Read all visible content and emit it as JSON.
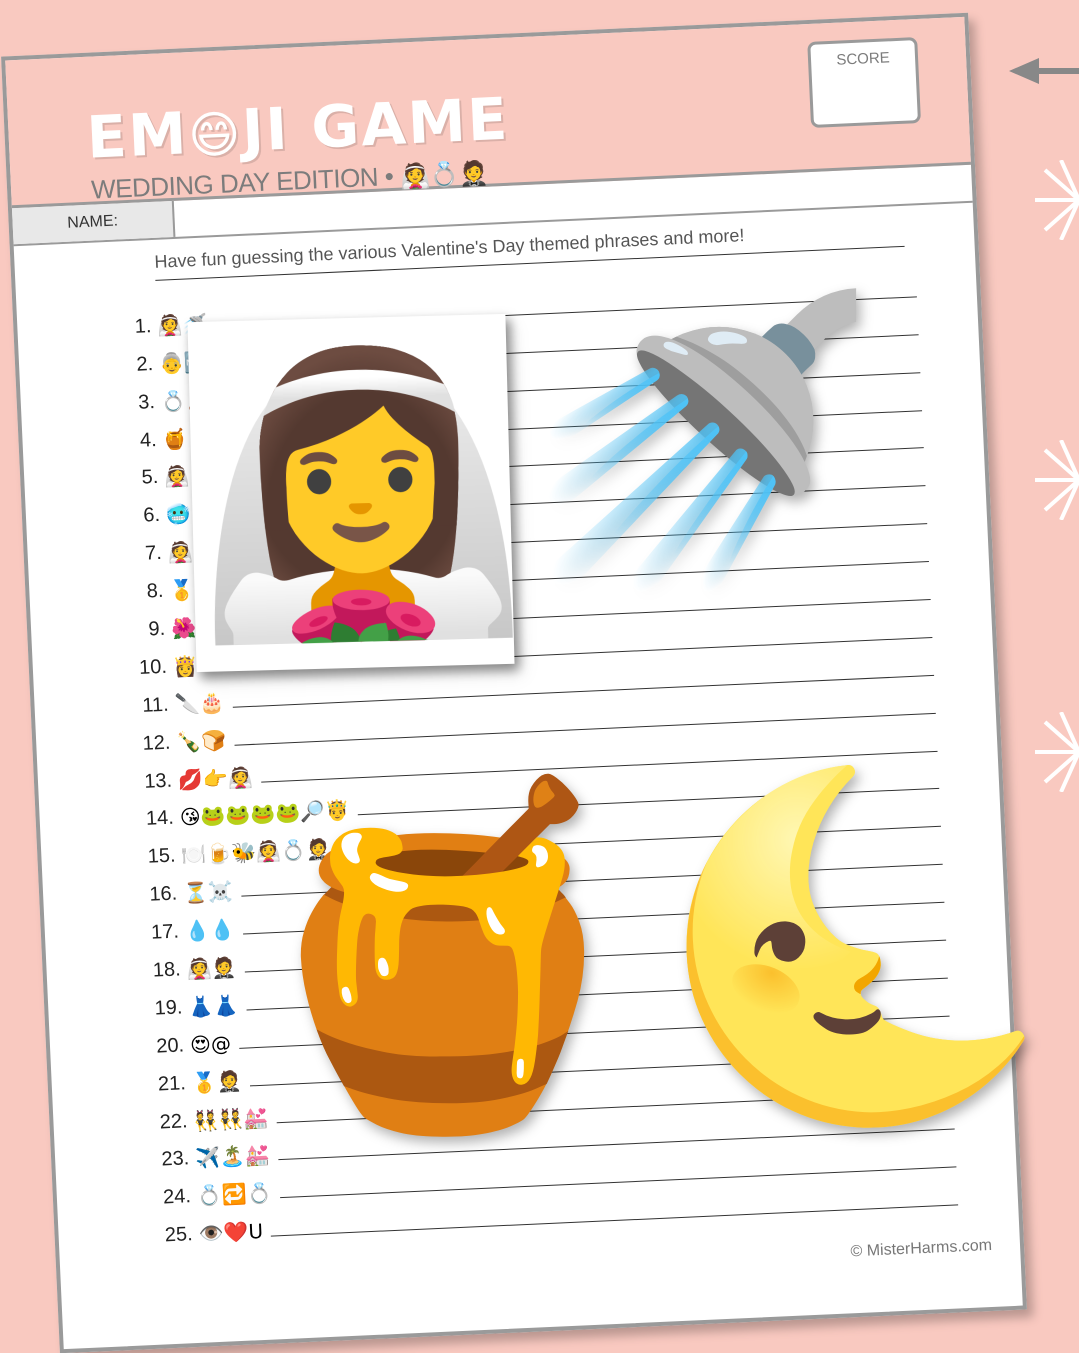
{
  "page": {
    "background": "#f9c9c0",
    "accent": "#9a9a9a"
  },
  "header": {
    "title_left": "EM",
    "title_emoji": "😄",
    "title_right": "JI GAME",
    "subtitle_text": "WEDDING DAY EDITION •",
    "subtitle_emojis": "👰💍🤵",
    "score_label": "SCORE"
  },
  "name_label": "NAME:",
  "intro": "Have fun guessing the various Valentine's Day themed phrases and more!",
  "clues": [
    {
      "num": "1.",
      "emoji": "👰🚿"
    },
    {
      "num": "2.",
      "emoji": "👵🆕🤝💙"
    },
    {
      "num": "3.",
      "emoji": "💍🧸"
    },
    {
      "num": "4.",
      "emoji": "🍯"
    },
    {
      "num": "5.",
      "emoji": "👰"
    },
    {
      "num": "6.",
      "emoji": "🥶"
    },
    {
      "num": "7.",
      "emoji": "👰"
    },
    {
      "num": "8.",
      "emoji": "🥇"
    },
    {
      "num": "9.",
      "emoji": "🌺"
    },
    {
      "num": "10.",
      "emoji": "👸"
    },
    {
      "num": "11.",
      "emoji": "🔪🎂"
    },
    {
      "num": "12.",
      "emoji": "🍾🍞"
    },
    {
      "num": "13.",
      "emoji": "💋👉👰"
    },
    {
      "num": "14.",
      "emoji": "😘🐸🐸🐸🐸🔎🤴"
    },
    {
      "num": "15.",
      "emoji": "🍽️🍺🐝👰💍🤵"
    },
    {
      "num": "16.",
      "emoji": "⏳☠️"
    },
    {
      "num": "17.",
      "emoji": "💧💧"
    },
    {
      "num": "18.",
      "emoji": "👰🤵"
    },
    {
      "num": "19.",
      "emoji": "👗👗"
    },
    {
      "num": "20.",
      "emoji": "😍@"
    },
    {
      "num": "21.",
      "emoji": "🥇🤵"
    },
    {
      "num": "22.",
      "emoji": "👯👯💒"
    },
    {
      "num": "23.",
      "emoji": "✈️🏝️💒"
    },
    {
      "num": "24.",
      "emoji": "💍🔁💍"
    },
    {
      "num": "25.",
      "emoji": "👁️❤️U"
    }
  ],
  "credit": "© MisterHarms.com",
  "overlays": {
    "bride": "👰‍♀️",
    "shower": "🚿",
    "honey": "🍯",
    "moon": "🌜"
  },
  "decor": {
    "arrow_icon": "left-arrow-icon",
    "burst_icon": "starburst-icon"
  }
}
